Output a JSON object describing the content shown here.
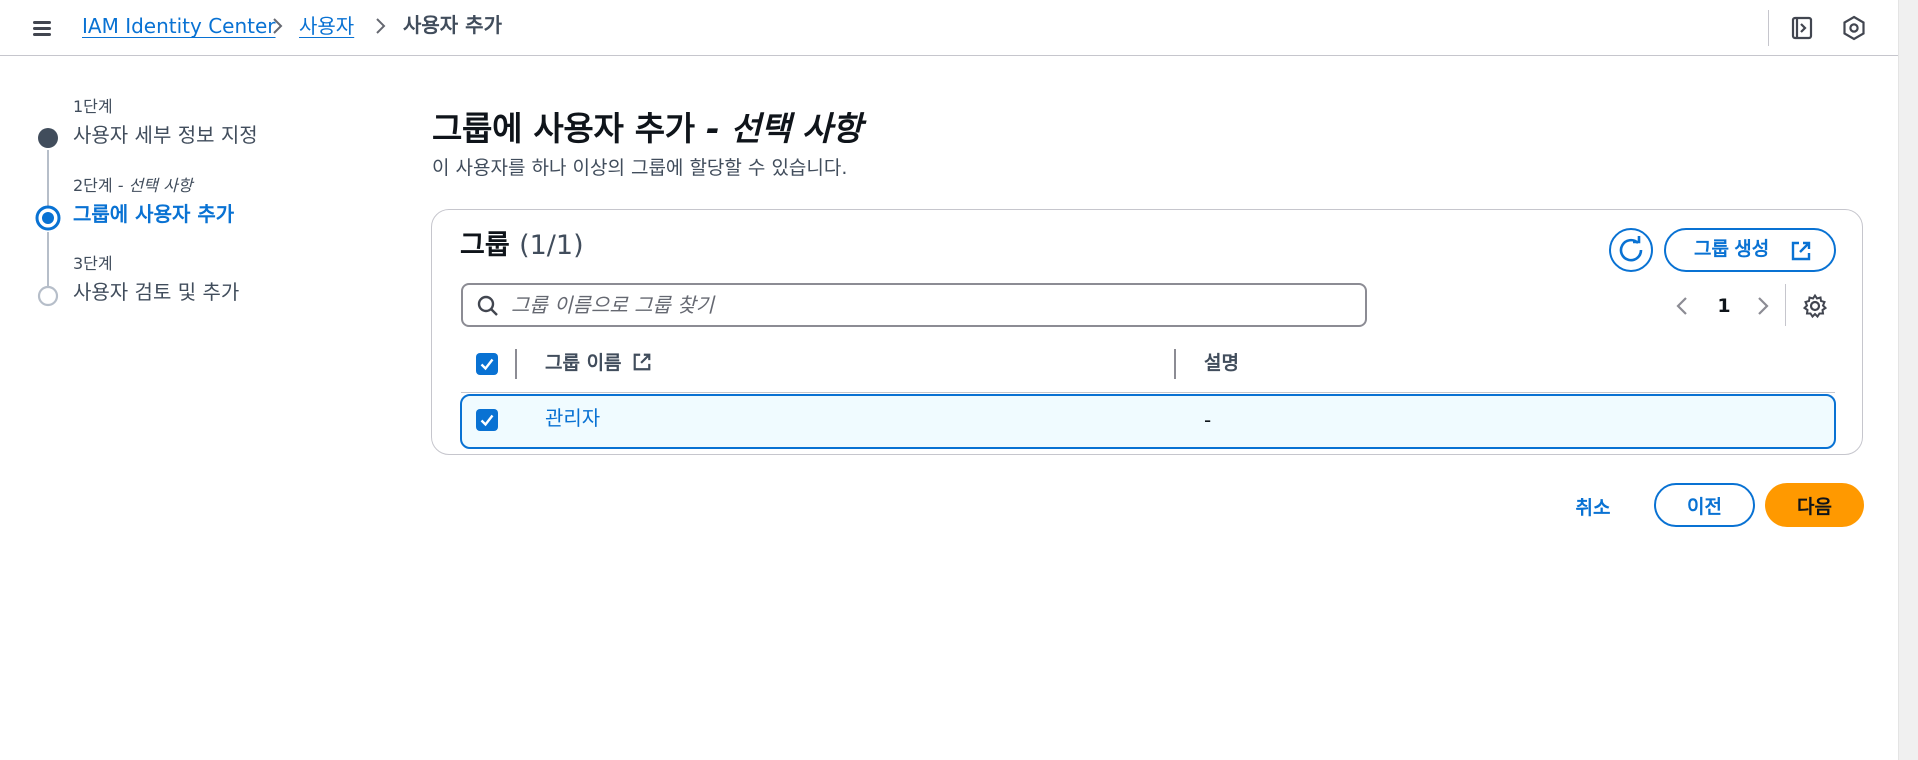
{
  "breadcrumb": {
    "items": [
      {
        "label": "IAM Identity Center"
      },
      {
        "label": "사용자"
      },
      {
        "label": "사용자 추가"
      }
    ]
  },
  "steps": [
    {
      "label": "1단계",
      "title": "사용자 세부 정보 지정",
      "state": "completed"
    },
    {
      "label": "2단계",
      "label_optional": " - 선택 사항",
      "title": "그룹에 사용자 추가",
      "state": "active"
    },
    {
      "label": "3단계",
      "title": "사용자 검토 및 추가",
      "state": "pending"
    }
  ],
  "page": {
    "title": "그룹에 사용자 추가",
    "title_optional": " - 선택 사항",
    "description": "이 사용자를 하나 이상의 그룹에 할당할 수 있습니다."
  },
  "groups": {
    "title": "그룹",
    "count": "(1/1)",
    "create_label": "그룹 생성",
    "search_placeholder": "그룹 이름으로 그룹 찾기",
    "page_number": "1",
    "columns": [
      "그룹 이름",
      "설명"
    ],
    "rows": [
      {
        "name": "관리자",
        "description": "-",
        "selected": true
      }
    ]
  },
  "footer": {
    "cancel_label": "취소",
    "previous_label": "이전",
    "next_label": "다음"
  },
  "colors": {
    "link": "#0972d3",
    "primary_button": "#ff9900",
    "selected_row_bg": "#f0fbff"
  },
  "icons": {
    "menu": "hamburger-icon",
    "notifications_panel": "side-panel-icon",
    "settings_top": "hexagon-settings-icon",
    "refresh": "refresh-icon",
    "external": "external-link-icon",
    "search": "search-icon",
    "prev": "chevron-left-icon",
    "next": "chevron-right-icon",
    "preferences": "gear-icon"
  }
}
